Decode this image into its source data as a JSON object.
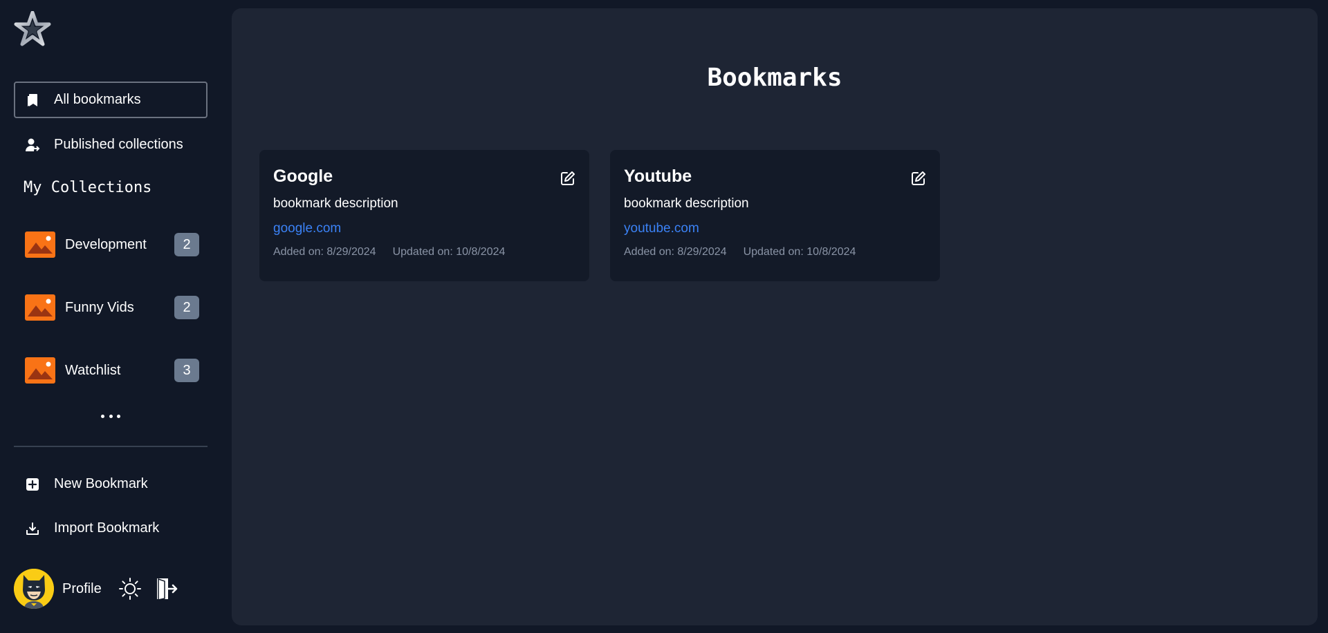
{
  "sidebar": {
    "nav": {
      "all_bookmarks": "All bookmarks",
      "published_collections": "Published collections"
    },
    "collections_title": "My Collections",
    "collections": [
      {
        "name": "Development",
        "count": "2"
      },
      {
        "name": "Funny Vids",
        "count": "2"
      },
      {
        "name": "Watchlist",
        "count": "3"
      }
    ],
    "actions": {
      "new_bookmark": "New Bookmark",
      "import_bookmark": "Import Bookmark"
    },
    "profile_label": "Profile"
  },
  "main": {
    "title": "Bookmarks",
    "bookmarks": [
      {
        "title": "Google",
        "description": "bookmark description",
        "link": "google.com",
        "added": "Added on: 8/29/2024",
        "updated": "Updated on: 10/8/2024"
      },
      {
        "title": "Youtube",
        "description": "bookmark description",
        "link": "youtube.com",
        "added": "Added on: 8/29/2024",
        "updated": "Updated on: 10/8/2024"
      }
    ]
  },
  "colors": {
    "background": "#111827",
    "panel": "#1e2534",
    "card": "#131a28",
    "link": "#3b82f6",
    "badge": "#6b7a8f",
    "thumb": "#f97316"
  },
  "icons": {
    "logo": "star-logo-icon",
    "all_bookmarks": "bookmarks-icon",
    "published_collections": "user-share-icon",
    "collection_thumb": "image-placeholder-icon",
    "more": "more-horizontal-icon",
    "new_bookmark": "plus-square-icon",
    "import_bookmark": "download-tray-icon",
    "theme": "sun-icon",
    "logout": "logout-door-icon",
    "edit": "edit-icon"
  }
}
